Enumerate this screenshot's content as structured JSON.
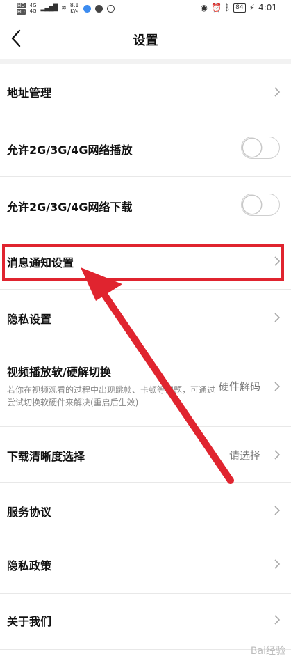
{
  "status_bar": {
    "hd1": "HD",
    "hd2": "HD",
    "signal1": "4G",
    "signal2": "4G",
    "speed_value": "8.1",
    "speed_unit": "K/s",
    "battery": "84",
    "time": "4:01"
  },
  "header": {
    "title": "设置"
  },
  "rows": [
    {
      "label": "地址管理"
    },
    {
      "label": "允许2G/3G/4G网络播放"
    },
    {
      "label": "允许2G/3G/4G网络下载"
    },
    {
      "label": "消息通知设置"
    },
    {
      "label": "隐私设置"
    },
    {
      "label": "视频播放软/硬解切换",
      "sub": "若你在视频观看的过程中出现跳帧、卡顿等问题，可通过尝试切换软硬件来解决(重启后生效)",
      "value": "硬件解码"
    },
    {
      "label": "下载清晰度选择",
      "value": "请选择"
    },
    {
      "label": "服务协议"
    },
    {
      "label": "隐私政策"
    },
    {
      "label": "关于我们"
    }
  ],
  "toggles": {
    "play_on_mobile": false,
    "download_on_mobile": false
  },
  "annotation_color": "#e0242f",
  "watermark": "Bai经验"
}
